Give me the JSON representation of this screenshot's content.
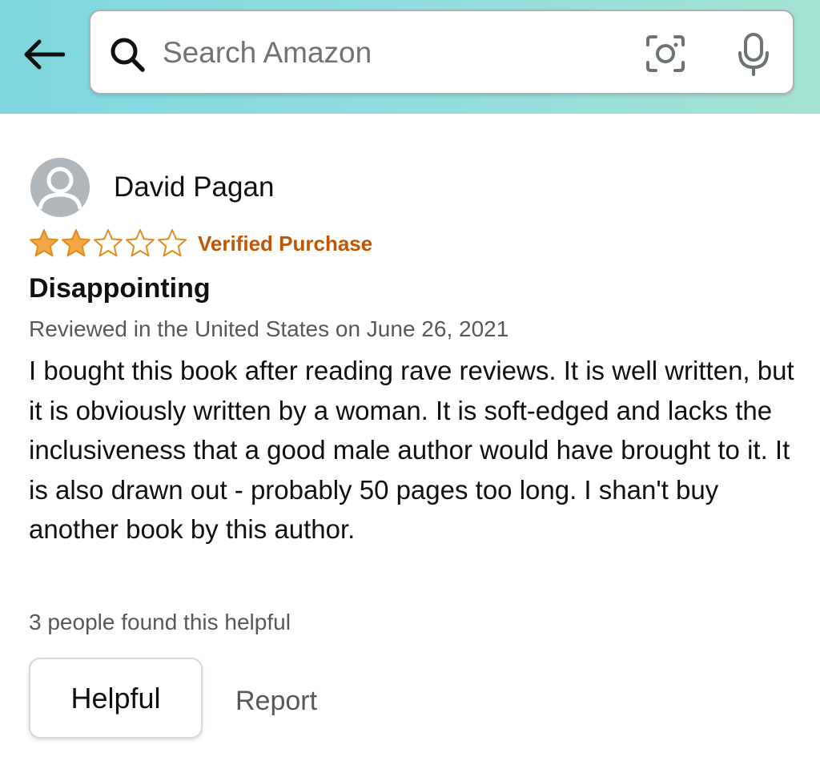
{
  "header": {
    "back_icon": "back-arrow-icon",
    "search": {
      "placeholder": "Search Amazon",
      "value": "",
      "icons": [
        "search-icon",
        "camera-scan-icon",
        "microphone-icon"
      ]
    }
  },
  "review": {
    "reviewer_name": "David Pagan",
    "avatar_icon": "default-user-avatar-icon",
    "rating": 2,
    "rating_max": 5,
    "verified_label": "Verified Purchase",
    "title": "Disappointing",
    "meta": "Reviewed in the United States on June 26, 2021",
    "body": "I bought this book after reading rave reviews. It is well written, but it is obviously written by a woman. It is soft-edged and lacks the inclusiveness that a good male author would have brought to it. It is also drawn out - probably 50 pages too long. I shan't buy another book by this author.",
    "helpful_count_text": "3 people found this helpful",
    "helpful_button_label": "Helpful",
    "report_label": "Report"
  },
  "colors": {
    "header_gradient_start": "#7fd6de",
    "header_gradient_end": "#a4e3d3",
    "star_fill": "#f3a847",
    "star_outline": "#e48a1f",
    "verified": "#c45500",
    "secondary_text": "#565959",
    "primary_text": "#0f1111"
  }
}
